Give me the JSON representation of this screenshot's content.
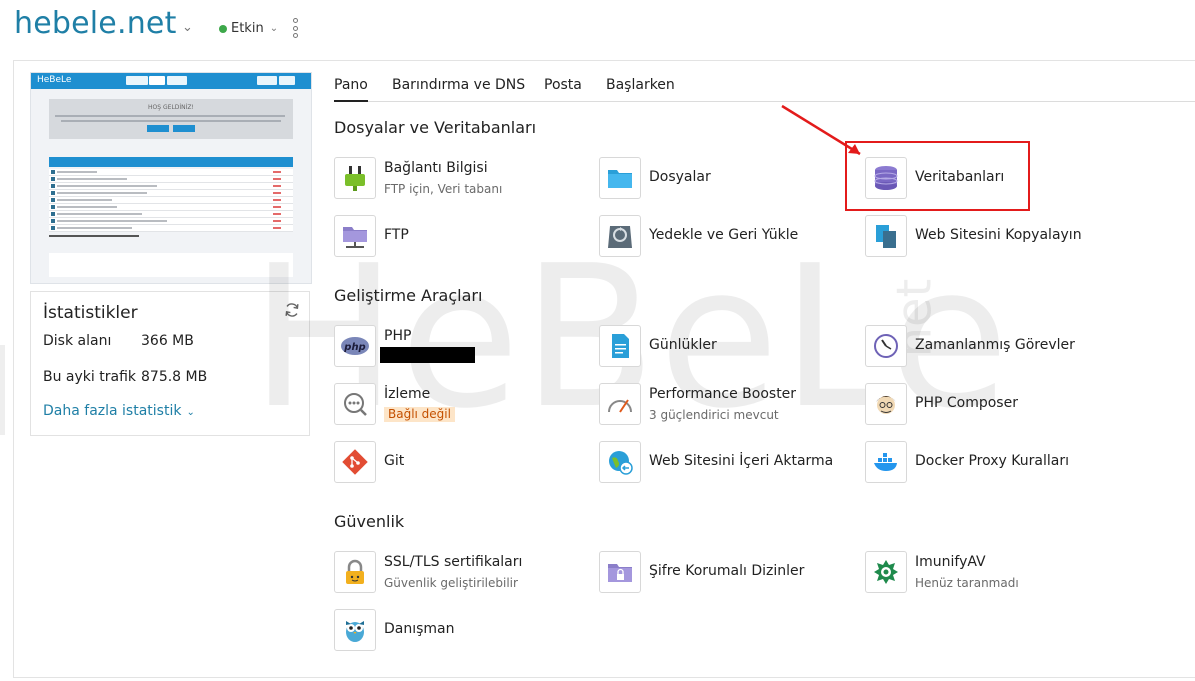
{
  "header": {
    "site_title": "hebele.net",
    "status_label": "Etkin"
  },
  "stats": {
    "title": "İstatistikler",
    "rows": [
      {
        "label": "Disk alanı",
        "value": "366 MB"
      },
      {
        "label": "Bu ayki trafik",
        "value": "875.8 MB"
      }
    ],
    "more_link": "Daha fazla istatistik"
  },
  "watermark": {
    "text": "HeBeLe",
    "suffix": "net"
  },
  "tabs": [
    {
      "label": "Pano",
      "active": true
    },
    {
      "label": "Barındırma ve DNS"
    },
    {
      "label": "Posta"
    },
    {
      "label": "Başlarken"
    }
  ],
  "sections": {
    "files": {
      "title": "Dosyalar ve Veritabanları",
      "tiles": [
        {
          "label": "Bağlantı Bilgisi",
          "sub": "FTP için, Veri tabanı"
        },
        {
          "label": "Dosyalar"
        },
        {
          "label": "Veritabanları"
        },
        {
          "label": "FTP"
        },
        {
          "label": "Yedekle ve Geri Yükle"
        },
        {
          "label": "Web Sitesini Kopyalayın"
        }
      ]
    },
    "dev": {
      "title": "Geliştirme Araçları",
      "tiles": [
        {
          "label": "PHP"
        },
        {
          "label": "Günlükler"
        },
        {
          "label": "Zamanlanmış Görevler"
        },
        {
          "label": "İzleme",
          "badge": "Bağlı değil"
        },
        {
          "label": "Performance Booster",
          "sub": "3 güçlendirici mevcut"
        },
        {
          "label": "PHP Composer"
        },
        {
          "label": "Git"
        },
        {
          "label": "Web Sitesini İçeri Aktarma"
        },
        {
          "label": "Docker Proxy Kuralları"
        }
      ]
    },
    "security": {
      "title": "Güvenlik",
      "tiles": [
        {
          "label": "SSL/TLS sertifikaları",
          "sub": "Güvenlik geliştirilebilir"
        },
        {
          "label": "Şifre Korumalı Dizinler"
        },
        {
          "label": "ImunifyAV",
          "sub": "Henüz taranmadı"
        },
        {
          "label": "Danışman"
        }
      ]
    }
  },
  "thumbnail": {
    "logo": "HeBeLe",
    "banner_title": "HOŞ GELDİNİZ!"
  },
  "colors": {
    "brand": "#1f7fa6",
    "status_green": "#3da84a",
    "highlight_red": "#e31b1b",
    "badge_bg": "#fde5c8",
    "badge_text": "#c45000"
  }
}
